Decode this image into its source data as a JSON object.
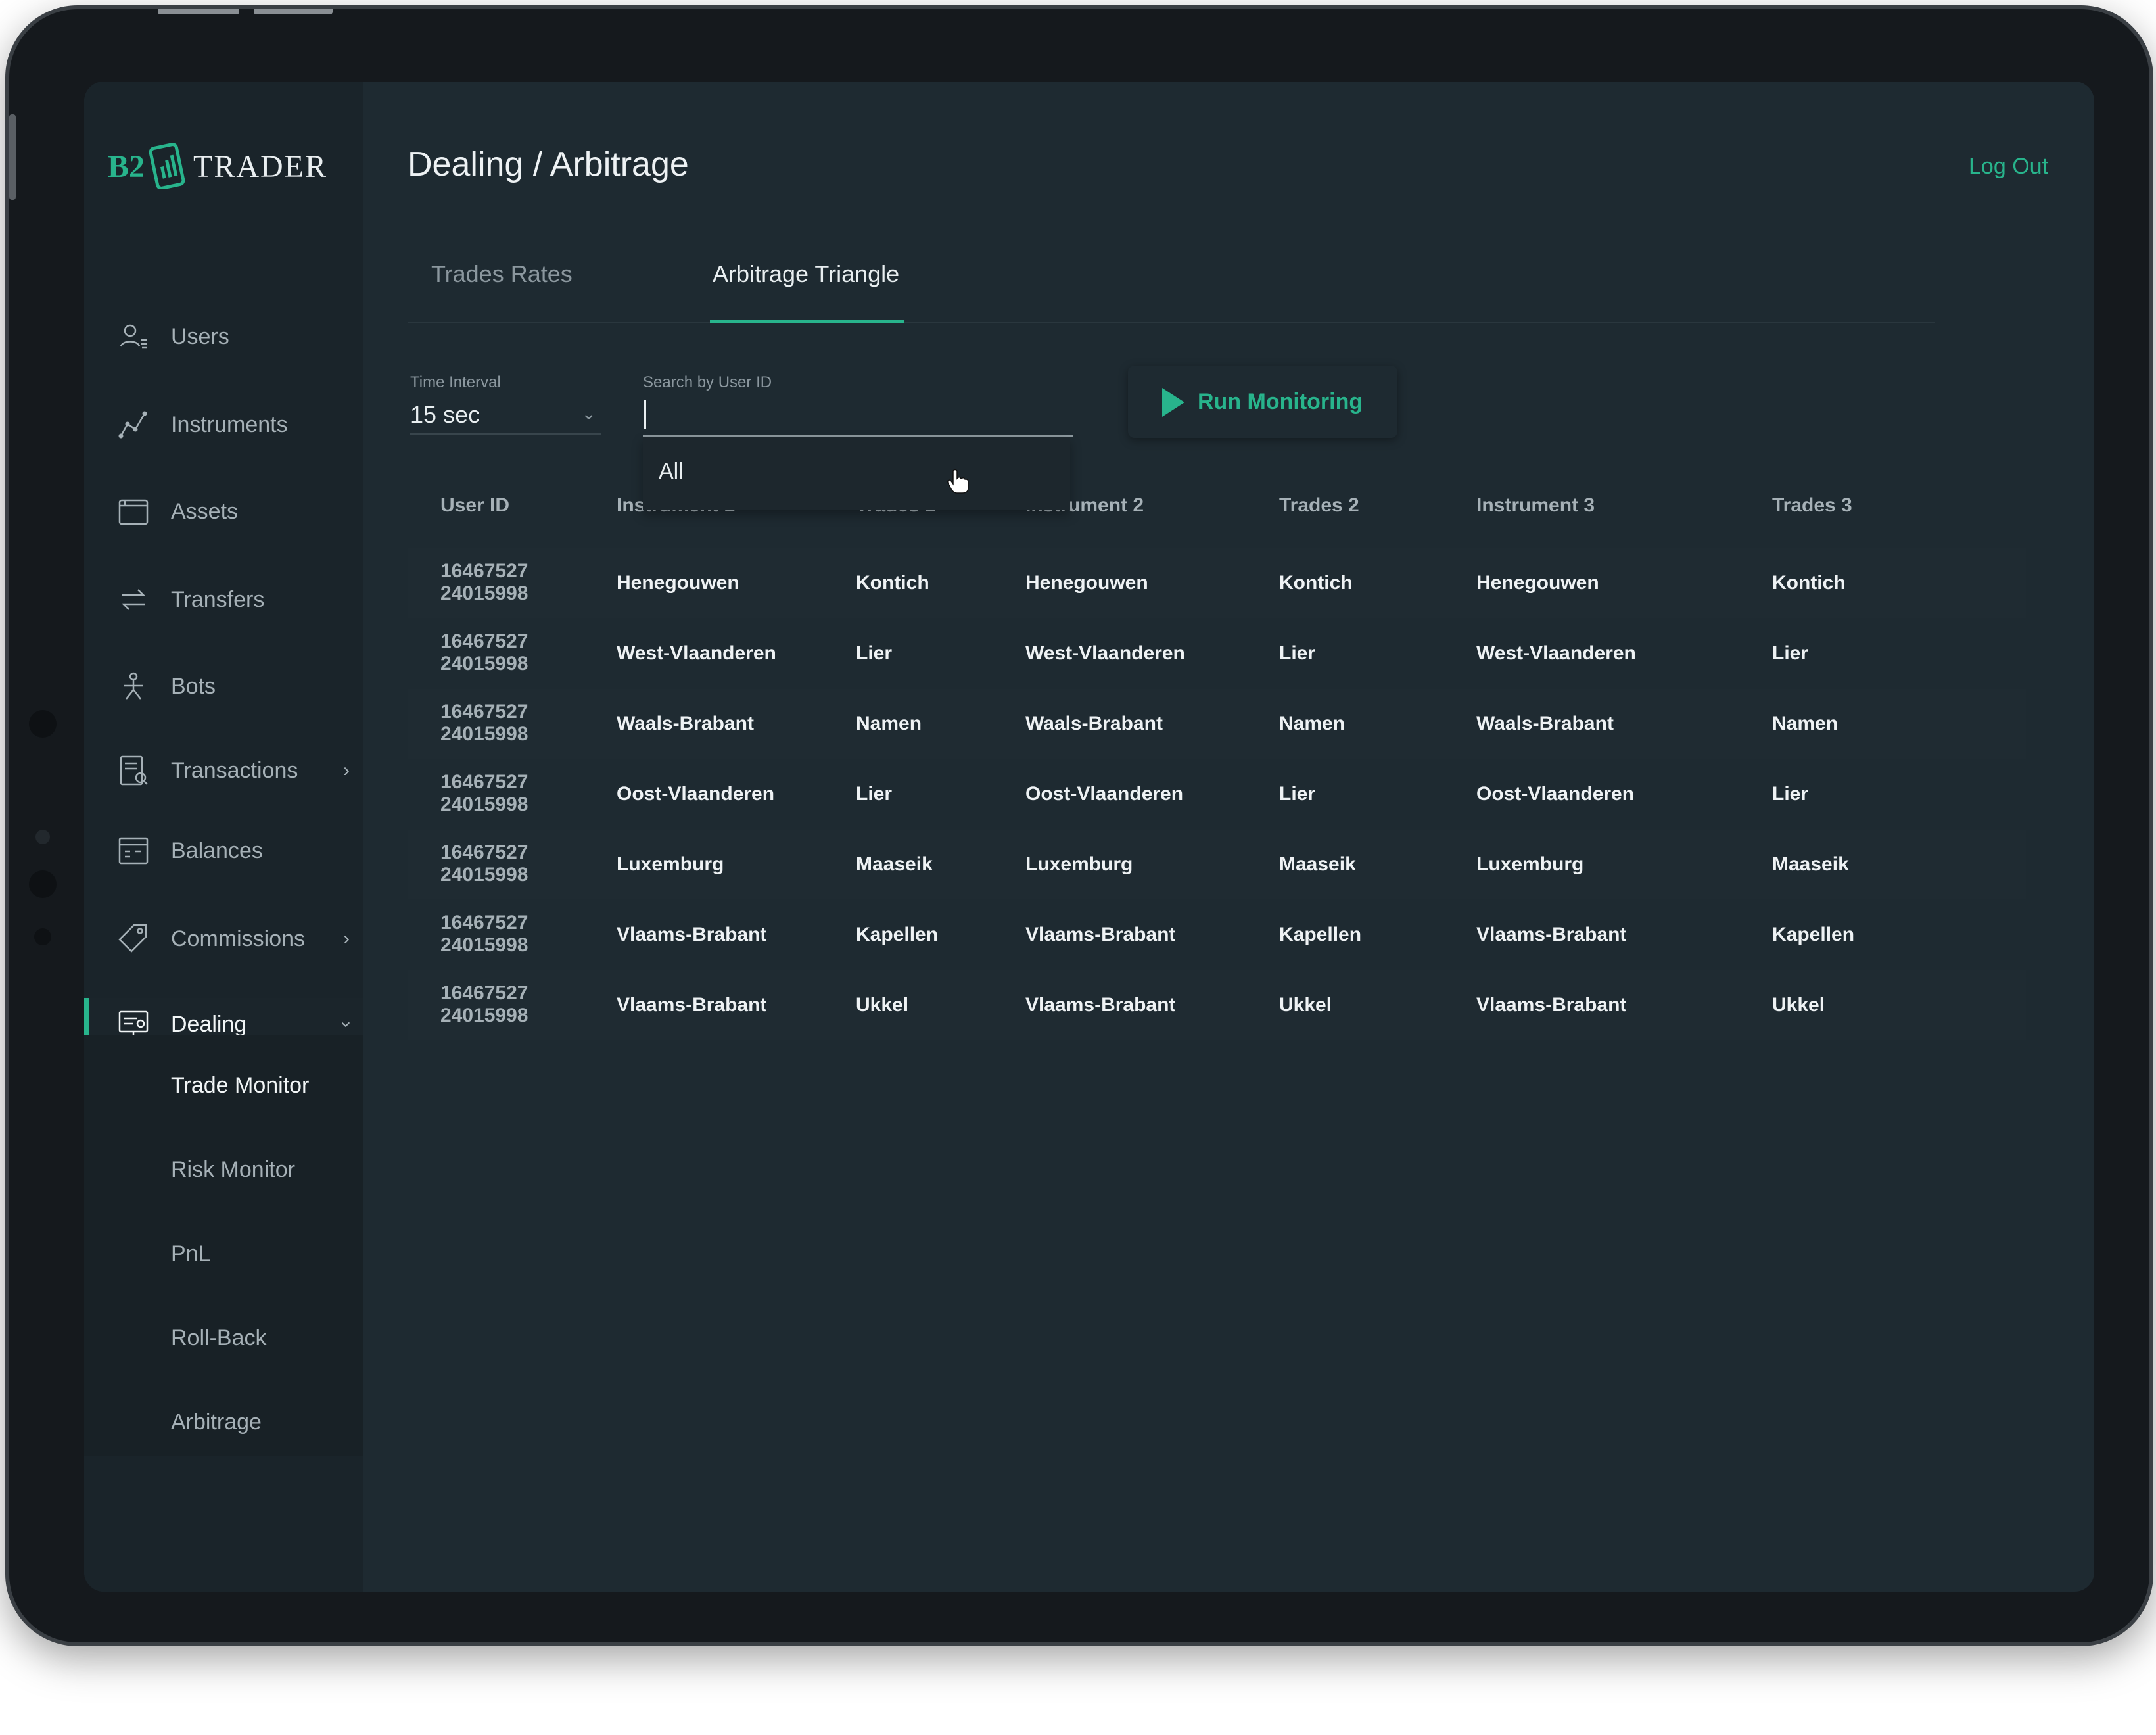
{
  "app": {
    "brand_prefix": "B2",
    "brand_name": "TRADER"
  },
  "header": {
    "title": "Dealing / Arbitrage",
    "logout_label": "Log Out"
  },
  "sidebar": {
    "items": [
      {
        "label": "Users",
        "icon": "user-icon"
      },
      {
        "label": "Instruments",
        "icon": "chart-line-icon"
      },
      {
        "label": "Assets",
        "icon": "folder-icon"
      },
      {
        "label": "Transfers",
        "icon": "transfer-arrows-icon"
      },
      {
        "label": "Bots",
        "icon": "bot-network-icon"
      },
      {
        "label": "Transactions",
        "icon": "receipt-icon"
      },
      {
        "label": "Balances",
        "icon": "calendar-grid-icon"
      },
      {
        "label": "Commissions",
        "icon": "tag-icon"
      },
      {
        "label": "Dealing",
        "icon": "monitor-icon"
      }
    ],
    "submenu": [
      "Trade Monitor",
      "Risk Monitor",
      "PnL",
      "Roll-Back",
      "Arbitrage"
    ]
  },
  "tabs": [
    {
      "label": "Trades Rates"
    },
    {
      "label": "Arbitrage Triangle"
    }
  ],
  "filters": {
    "time_interval": {
      "label": "Time Interval",
      "value": "15 sec"
    },
    "search": {
      "label": "Search by User ID",
      "value": "",
      "dropdown_option": "All"
    },
    "run_label": "Run Monitoring"
  },
  "table": {
    "columns": [
      "User ID",
      "Instrument 1",
      "Trades 1",
      "Instrument 2",
      "Trades 2",
      "Instrument 3",
      "Trades 3"
    ],
    "rows": [
      {
        "uid_a": "16467527",
        "uid_b": "24015998",
        "i1": "Henegouwen",
        "t1": "Kontich",
        "i2": "Henegouwen",
        "t2": "Kontich",
        "i3": "Henegouwen",
        "t3": "Kontich"
      },
      {
        "uid_a": "16467527",
        "uid_b": "24015998",
        "i1": "West-Vlaanderen",
        "t1": "Lier",
        "i2": "West-Vlaanderen",
        "t2": "Lier",
        "i3": "West-Vlaanderen",
        "t3": "Lier"
      },
      {
        "uid_a": "16467527",
        "uid_b": "24015998",
        "i1": "Waals-Brabant",
        "t1": "Namen",
        "i2": "Waals-Brabant",
        "t2": "Namen",
        "i3": "Waals-Brabant",
        "t3": "Namen"
      },
      {
        "uid_a": "16467527",
        "uid_b": "24015998",
        "i1": "Oost-Vlaanderen",
        "t1": "Lier",
        "i2": "Oost-Vlaanderen",
        "t2": "Lier",
        "i3": "Oost-Vlaanderen",
        "t3": "Lier"
      },
      {
        "uid_a": "16467527",
        "uid_b": "24015998",
        "i1": "Luxemburg",
        "t1": "Maaseik",
        "i2": "Luxemburg",
        "t2": "Maaseik",
        "i3": "Luxemburg",
        "t3": "Maaseik"
      },
      {
        "uid_a": "16467527",
        "uid_b": "24015998",
        "i1": "Vlaams-Brabant",
        "t1": "Kapellen",
        "i2": "Vlaams-Brabant",
        "t2": "Kapellen",
        "i3": "Vlaams-Brabant",
        "t3": "Kapellen"
      },
      {
        "uid_a": "16467527",
        "uid_b": "24015998",
        "i1": "Vlaams-Brabant",
        "t1": "Ukkel",
        "i2": "Vlaams-Brabant",
        "t2": "Ukkel",
        "i3": "Vlaams-Brabant",
        "t3": "Ukkel"
      }
    ]
  },
  "colors": {
    "accent": "#28b48c",
    "background": "#1e2a31",
    "sidebar": "#1a242a"
  }
}
